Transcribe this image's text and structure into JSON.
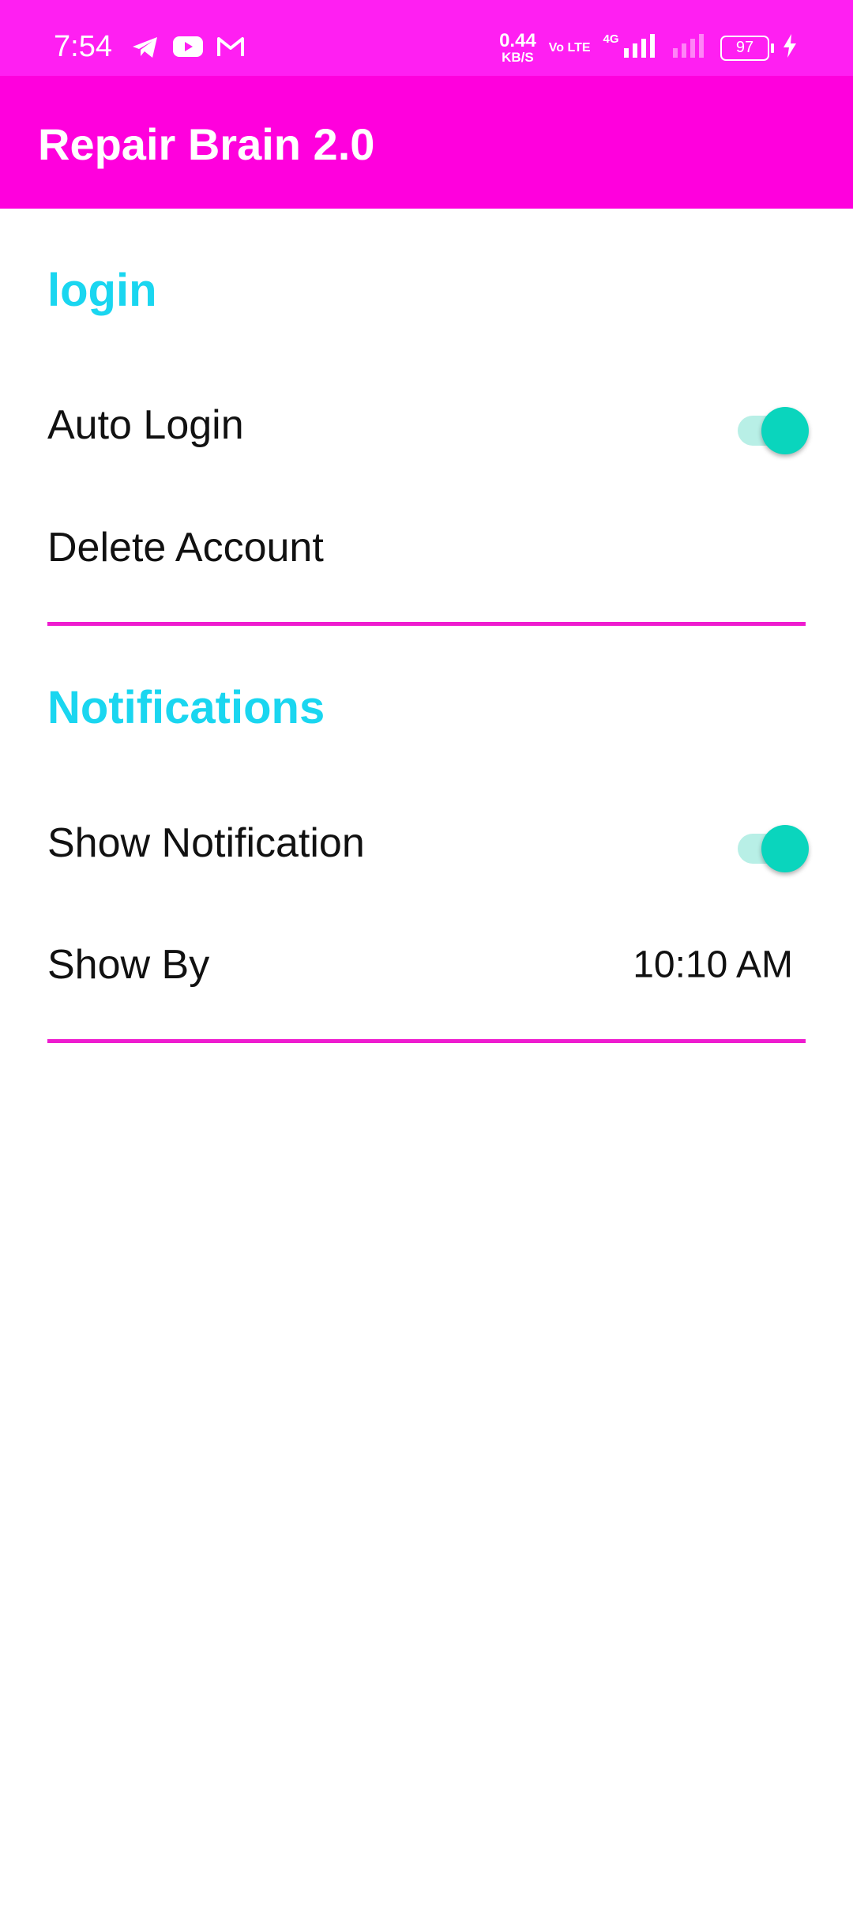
{
  "status_bar": {
    "time": "7:54",
    "net_speed_value": "0.44",
    "net_speed_unit": "KB/S",
    "volte": "Vo LTE",
    "network": "4G",
    "battery": "97",
    "icons": [
      "telegram-icon",
      "youtube-icon",
      "gmail-icon",
      "signal-icon",
      "charging-icon"
    ],
    "color": "#ff1ff2"
  },
  "app_bar": {
    "title": "Repair Brain 2.0",
    "color": "#ff00dd"
  },
  "sections": {
    "login": {
      "header": "login",
      "auto_login_label": "Auto Login",
      "auto_login_on": true,
      "delete_account_label": "Delete Account"
    },
    "notifications": {
      "header": "Notifications",
      "show_notification_label": "Show Notification",
      "show_notification_on": true,
      "show_by_label": "Show By",
      "show_by_value": "10:10 AM"
    }
  },
  "colors": {
    "section_header": "#1ad6f0",
    "divider": "#ee1ccf",
    "switch_thumb": "#0ad5bd",
    "switch_track": "#b8efe6"
  }
}
